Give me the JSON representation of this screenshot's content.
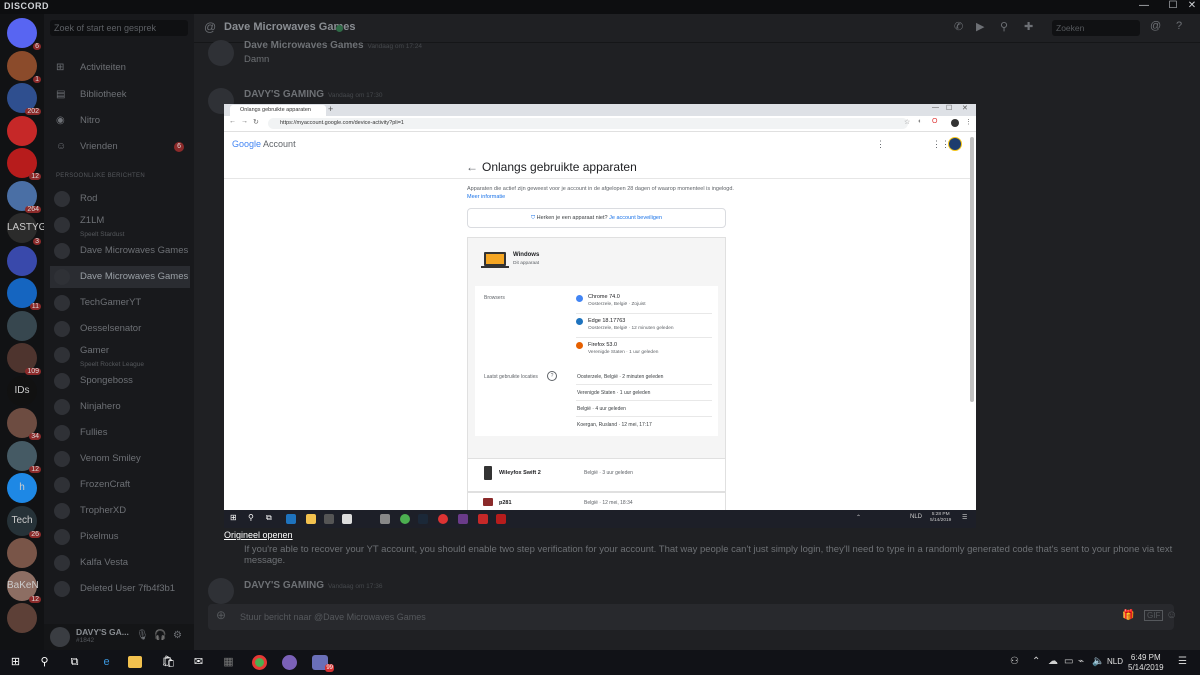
{
  "discord": {
    "title": "DISCORD",
    "window_controls": [
      "—",
      "☐",
      "✕"
    ],
    "search_placeholder": "Zoek of start een gesprek",
    "nav": [
      {
        "label": "Activiteiten"
      },
      {
        "label": "Bibliotheek"
      },
      {
        "label": "Nitro"
      },
      {
        "label": "Vrienden",
        "badge": "6"
      }
    ],
    "dm_header": "PERSOONLIJKE BERICHTEN",
    "dms": [
      {
        "name": "Rod"
      },
      {
        "name": "Z1LM",
        "sub": "Speelt Stardust"
      },
      {
        "name": "Dave Microwaves Games"
      },
      {
        "name": "Dave Microwaves Games",
        "active": true
      },
      {
        "name": "TechGamerYT"
      },
      {
        "name": "Oesselsenator"
      },
      {
        "name": "Gamer",
        "sub": "Speelt Rocket League"
      },
      {
        "name": "Spongeboss"
      },
      {
        "name": "Ninjahero"
      },
      {
        "name": "Fullies"
      },
      {
        "name": "Venom Smiley"
      },
      {
        "name": "FrozenCraft"
      },
      {
        "name": "TropherXD"
      },
      {
        "name": "Pixelmus"
      },
      {
        "name": "Kalfa Vesta"
      },
      {
        "name": "Deleted User 7fb4f3b1"
      }
    ],
    "server_badges": [
      "6",
      "1",
      "202",
      "",
      "12",
      "264",
      "3",
      "",
      "11",
      "",
      "109",
      "",
      "34",
      "12",
      "",
      "26",
      "",
      "12",
      ""
    ],
    "server_texts": [
      "",
      "",
      "",
      "",
      "",
      "",
      "LASTYGAM",
      "",
      "",
      "",
      "",
      "IDs",
      "",
      "",
      "h",
      "Tech",
      "",
      "BaKeN",
      ""
    ],
    "user": {
      "name": "DAVY'S GA...",
      "tag": "#1842"
    },
    "channel_title": "Dave Microwaves Games",
    "chat_search": "Zoeken",
    "messages_top": [
      {
        "name": "Dave Microwaves Games",
        "time": "Vandaag om 17:24",
        "text": "Damn"
      },
      {
        "name": "DAVY'S GAMING",
        "time": "Vandaag om 17:30",
        "text": ""
      }
    ],
    "open_link": "Origineel openen",
    "advice_text": "If you're able to recover your YT account, you should enable two step verification for your account. That way people can't just simply login, they'll need to type in a randomly generated code that's sent to your phone via text message.",
    "bottom_message": {
      "name": "DAVY'S GAMING",
      "time": "Vandaag om 17:36"
    },
    "input_placeholder": "Stuur bericht naar @Dave Microwaves Games"
  },
  "screenshot": {
    "tab_title": "Onlangs gebruikte apparaten",
    "url": "https://myaccount.google.com/device-activity?pli=1",
    "logo_google": "Google",
    "logo_account": "Account",
    "page_title": "Onlangs gebruikte apparaten",
    "description": "Apparaten die actief zijn geweest voor je account in de afgelopen 28 dagen of waarop momenteel is ingelogd.",
    "more_info": "Meer informatie",
    "secure_question": "Herken je een apparaat niet?",
    "secure_link": "Je account beveiligen",
    "device": {
      "name": "Windows",
      "sub": "Dit apparaat"
    },
    "browsers_label": "Browsers",
    "browsers": [
      {
        "name": "Chrome 74.0",
        "sub": "Oosterzele, België · Zojuist",
        "color": "#4285f4"
      },
      {
        "name": "Edge 18.17763",
        "sub": "Oosterzele, België · 12 minuten geleden",
        "color": "#1e73be"
      },
      {
        "name": "Firefox 53.0",
        "sub": "Verenigde Staten · 1 uur geleden",
        "color": "#e66000"
      }
    ],
    "locations_label": "Laatst gebruikte locaties",
    "locations": [
      "Oosterzele, België · 2 minuten geleden",
      "Verenigde Staten · 1 uur geleden",
      "België · 4 uur geleden",
      "Koergan, Rusland · 12 mei, 17:17"
    ],
    "other_devices": [
      {
        "name": "Wileyfox Swift 2",
        "loc": "België · 3 uur geleden"
      },
      {
        "name": "p281",
        "loc": "België · 12 mei, 18:34"
      }
    ],
    "taskbar_time": "5:28 PM",
    "taskbar_date": "5/14/2019",
    "taskbar_lang": "NLD"
  },
  "taskbar": {
    "time": "6:49 PM",
    "date": "5/14/2019",
    "lang": "NLD",
    "discord_badge": "99"
  }
}
